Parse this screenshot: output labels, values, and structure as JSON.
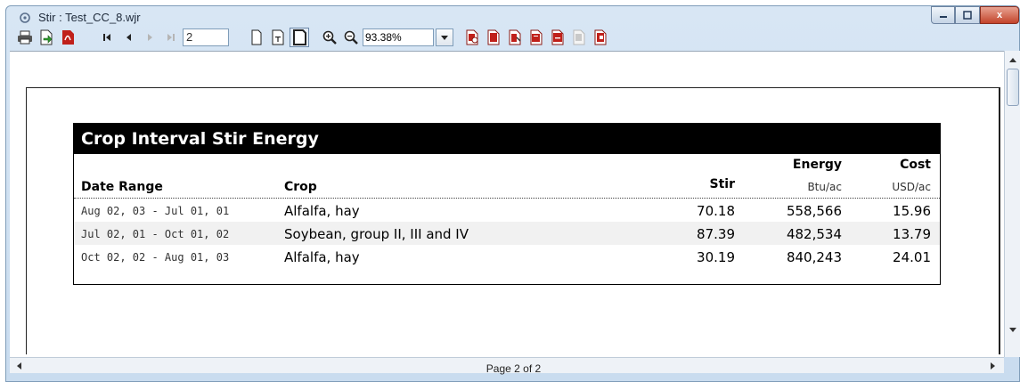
{
  "window": {
    "title": "Stir : Test_CC_8.wjr",
    "minimize_icon": "minimize-icon",
    "maximize_icon": "maximize-icon",
    "close_glyph": "x"
  },
  "toolbar": {
    "page_number": "2",
    "zoom_value": "93.38%"
  },
  "report": {
    "title": "Crop Interval Stir Energy",
    "columns": {
      "date_range": "Date Range",
      "crop": "Crop",
      "stir": "Stir",
      "energy": "Energy",
      "energy_unit": "Btu/ac",
      "cost": "Cost",
      "cost_unit": "USD/ac"
    },
    "rows": [
      {
        "date_range": "Aug 02, 03 - Jul 01, 01",
        "crop": "Alfalfa, hay",
        "stir": "70.18",
        "energy": "558,566",
        "cost": "15.96"
      },
      {
        "date_range": "Jul 02, 01 - Oct 01, 02",
        "crop": "Soybean, group II, III and IV",
        "stir": "87.39",
        "energy": "482,534",
        "cost": "13.79"
      },
      {
        "date_range": "Oct 02, 02 - Aug 01, 03",
        "crop": "Alfalfa, hay",
        "stir": "30.19",
        "energy": "840,243",
        "cost": "24.01"
      }
    ]
  },
  "status": {
    "page_indicator": "Page 2 of 2"
  },
  "colors": {
    "report_header_bg": "#000000",
    "report_header_fg": "#ffffff",
    "alt_row_bg": "#f1f1f1",
    "toolbar_red_icon": "#c0201a"
  }
}
